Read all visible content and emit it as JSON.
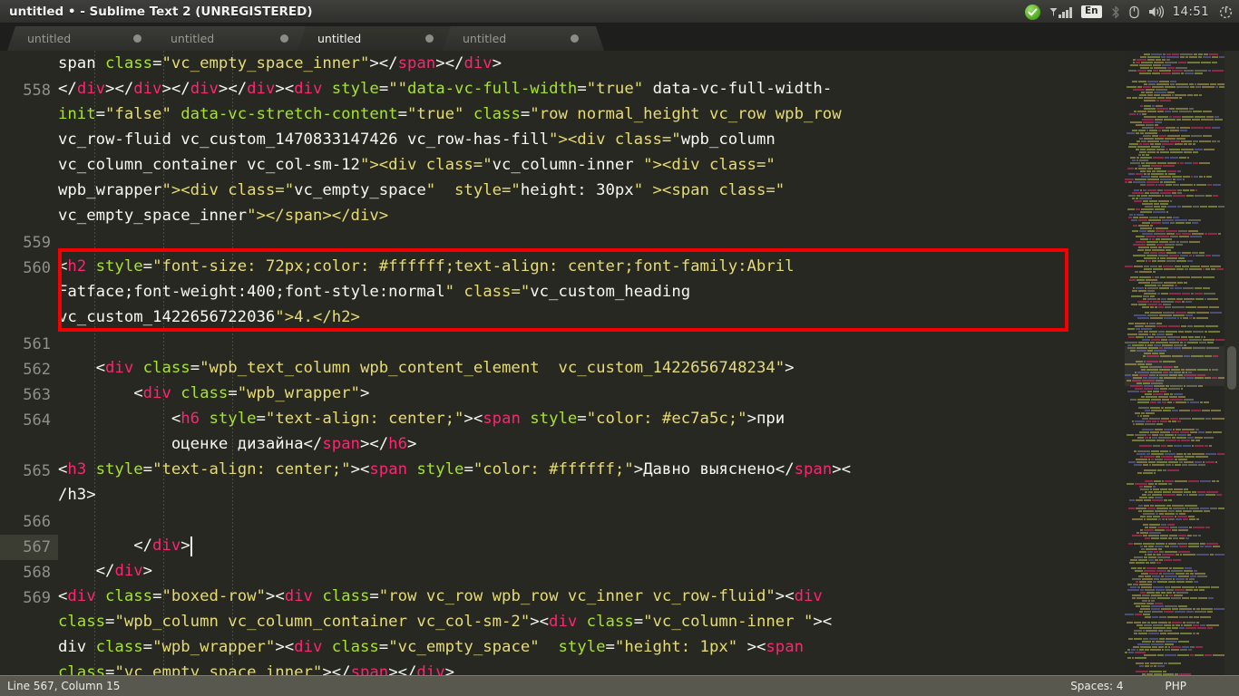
{
  "window": {
    "title": "untitled • - Sublime Text 2 (UNREGISTERED)"
  },
  "tray": {
    "skype_icon": "skype-check-icon",
    "signal_icon": "signal-bars-icon",
    "keyboard_layout": "En",
    "bluetooth_icon": "bluetooth-icon",
    "battery_icon": "battery-icon",
    "volume_icon": "volume-icon",
    "clock": "14:51",
    "settings_icon": "gear-power-icon"
  },
  "tabs": [
    {
      "label": "untitled",
      "active": false
    },
    {
      "label": "untitled",
      "active": false
    },
    {
      "label": "untitled",
      "active": true
    },
    {
      "label": "untitled",
      "active": false
    }
  ],
  "editor": {
    "gutter_numbers": [
      "",
      "558",
      "",
      "",
      "",
      "",
      "",
      "559",
      "560",
      "",
      "",
      "561",
      "562",
      "563",
      "564",
      "",
      "565",
      "",
      "566",
      "567",
      "568",
      "569",
      "",
      "",
      ""
    ],
    "active_gutter_index": 19,
    "cursor": {
      "line": 567,
      "column": 15
    },
    "highlight_box": {
      "from_line": 560,
      "to_line": 560,
      "color": "#f40000"
    },
    "lines": [
      "span class=\"vc_empty_space_inner\"></span></div>",
      "</div></div></div></div><div style=\"\"data-vc-full-width=\"true\" data-vc-full-width-",
      "init=\"false\" data-vc-stretch-content=\"true\" class=\"row normal_height vc_row wpb_row",
      "vc_row-fluid vc_custom_1470833147426 vc_row-has-fill\"><div class=\"wpb_column",
      "vc_column_container vc_col-sm-12\"><div class=\"vc_column-inner \"><div class=\"",
      "wpb_wrapper\"><div class=\"vc_empty_space\"  style=\"height: 30px\" ><span class=\"",
      "vc_empty_space_inner\"></span></div>",
      "",
      "<h2 style=\"font-size: 72px;color: #ffffff;text-align: center;font-family:Abril",
      "Fatface;font-weight:400;font-style:normal\" class=\"vc_custom_heading",
      "vc_custom_1422656722036\">4.</h2>",
      "",
      "    <div class=\"wpb_text_column wpb_content_element  vc_custom_1422656748234\">",
      "        <div class=\"wpb_wrapper\">",
      "            <h6 style=\"text-align: center;\"><span style=\"color: #ec7a5c;\">при",
      "            оценке дизайна</span></h6>",
      "<h3 style=\"text-align: center;\"><span style=\"color: #ffffff;\">Давно выяснено</span><",
      "/h3>",
      "",
      "        </div>",
      "    </div>",
      "<div class=\"boxed-row\"><div class=\"row vc_row wpb_row vc_inner vc_row-fluid\"><div",
      "class=\"wpb_column vc_column_container vc_col-sm-2\"><div class=\"vc_column-inner \"><",
      "div class=\"wpb_wrapper\"><div class=\"vc_empty_space\"  style=\"height: 1px\" ><span",
      "class=\"vc_empty_space_inner\"></span></div>"
    ]
  },
  "status": {
    "cursor_position": "Line 567, Column 15",
    "indentation": "Spaces: 4",
    "syntax": "PHP"
  },
  "colors": {
    "editor_bg": "#272822",
    "tag": "#f92672",
    "attribute": "#a6e22e",
    "string": "#e6db74",
    "plain": "#f8f8f2",
    "line_number": "#8f9089",
    "highlight": "#f40000",
    "statusbar_bg": "#58584f"
  }
}
